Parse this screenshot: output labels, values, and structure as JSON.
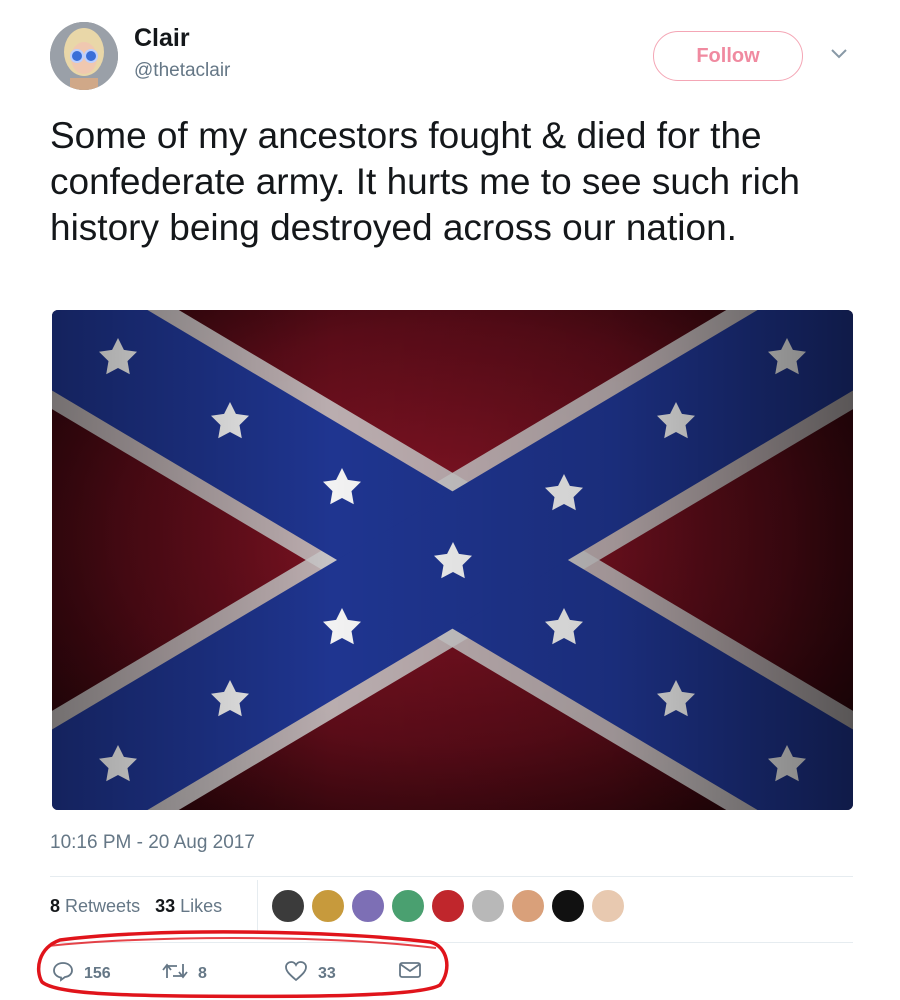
{
  "author": {
    "name": "Clair",
    "handle": "@thetaclair"
  },
  "follow_button": {
    "label": "Follow"
  },
  "tweet": {
    "text": "Some of my ancestors fought & died for the confederate army. It hurts me to see such rich history being destroyed across our nation.",
    "timestamp": "10:16 PM - 20 Aug 2017"
  },
  "stats": {
    "retweets_count": "8",
    "retweets_label": "Retweets",
    "likes_count": "33",
    "likes_label": "Likes"
  },
  "actions": {
    "reply_count": "156",
    "retweet_count": "8",
    "like_count": "33"
  },
  "colors": {
    "follow_accent": "#f08aa0",
    "muted_text": "#657786",
    "annotation_red": "#e0141b"
  },
  "icons": [
    "chevron-down-icon",
    "reply-icon",
    "retweet-icon",
    "heart-icon",
    "envelope-icon"
  ]
}
